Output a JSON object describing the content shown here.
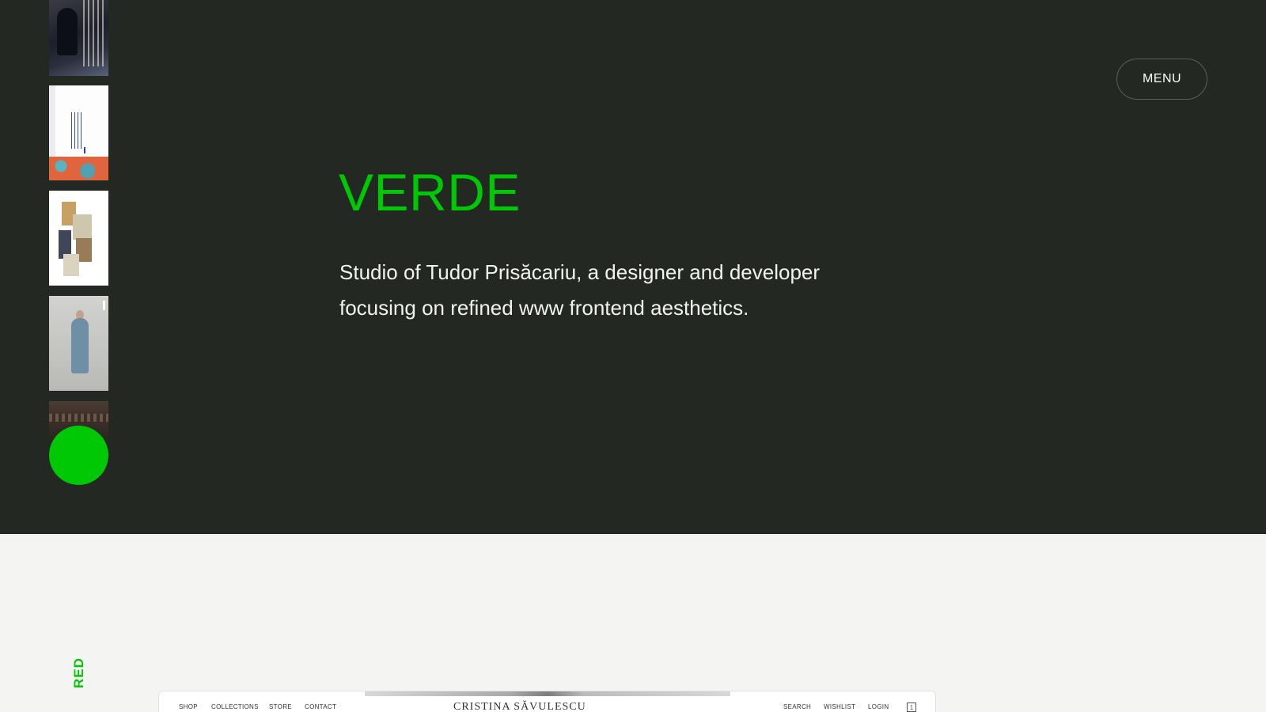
{
  "site": {
    "brand": "VERDE",
    "tagline": "Studio of Tudor Prisăcariu, a designer and developer focusing on refined www frontend aesthetics.",
    "menu_label": "MENU",
    "accent_color": "#00c805",
    "hero_background": "#232823",
    "page_background": "#f4f5f3"
  },
  "sidebar": {
    "thumbnails": [
      {
        "name": "project-thumbnail-1"
      },
      {
        "name": "project-thumbnail-2"
      },
      {
        "name": "project-thumbnail-3"
      },
      {
        "name": "project-thumbnail-4"
      },
      {
        "name": "project-thumbnail-5"
      }
    ],
    "section_label": "RED"
  },
  "preview": {
    "nav_left": [
      "SHOP",
      "COLLECTIONS",
      "STORE",
      "CONTACT"
    ],
    "title": "CRISTINA SĂVULESCU",
    "nav_right": [
      "SEARCH",
      "WISHLIST",
      "LOGIN"
    ],
    "cart_count": "1",
    "cart_icon": "bag-icon"
  }
}
